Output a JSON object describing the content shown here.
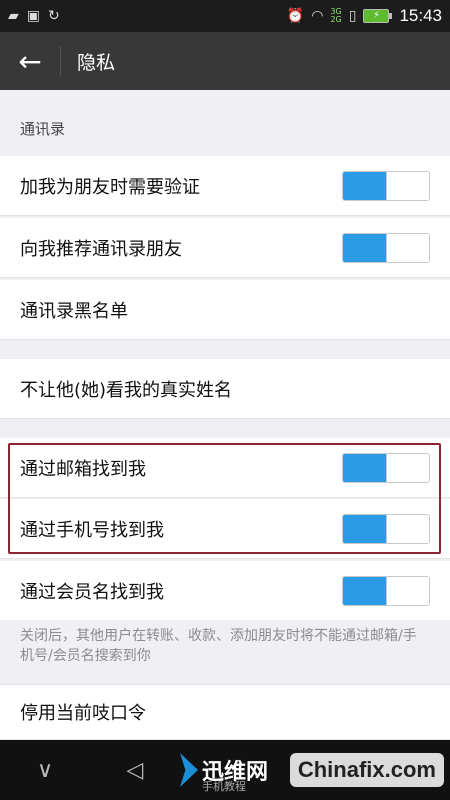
{
  "status_bar": {
    "left_icons": [
      "sim-card-icon",
      "image-icon",
      "sync-icon"
    ],
    "right_icons": [
      "alarm-icon",
      "wifi-icon",
      "signal-icon",
      "sim-icon",
      "battery-icon"
    ],
    "network_3g": "3G",
    "network_2g": "2G",
    "time": "15:43"
  },
  "header": {
    "back_glyph": "←",
    "title": "隐私"
  },
  "sections": {
    "contacts_header": "通讯录"
  },
  "rows": {
    "verify_friend": {
      "label": "加我为朋友时需要验证",
      "toggle_on": true
    },
    "recommend_contacts": {
      "label": "向我推荐通讯录朋友",
      "toggle_on": true
    },
    "contacts_blacklist": {
      "label": "通讯录黑名单"
    },
    "hide_real_name": {
      "label": "不让他(她)看我的真实姓名"
    },
    "find_by_email": {
      "label": "通过邮箱找到我",
      "toggle_on": true
    },
    "find_by_phone": {
      "label": "通过手机号找到我",
      "toggle_on": true
    },
    "find_by_member": {
      "label": "通过会员名找到我",
      "toggle_on": true
    },
    "disable_password": {
      "label": "停用当前吱口令"
    }
  },
  "note": "关闭后，其他用户在转账、收款、添加朋友时将不能通过邮箱/手机号/会员名搜索到你",
  "nav": {
    "back_glyph": "∨",
    "home_glyph": "◁"
  },
  "watermark": {
    "brand": "迅维网",
    "sub": "手机教程",
    "site": "Chinafix.com"
  },
  "colors": {
    "toggle_on": "#2b9be6",
    "title_bar": "#383838",
    "highlight": "#8b2530"
  }
}
